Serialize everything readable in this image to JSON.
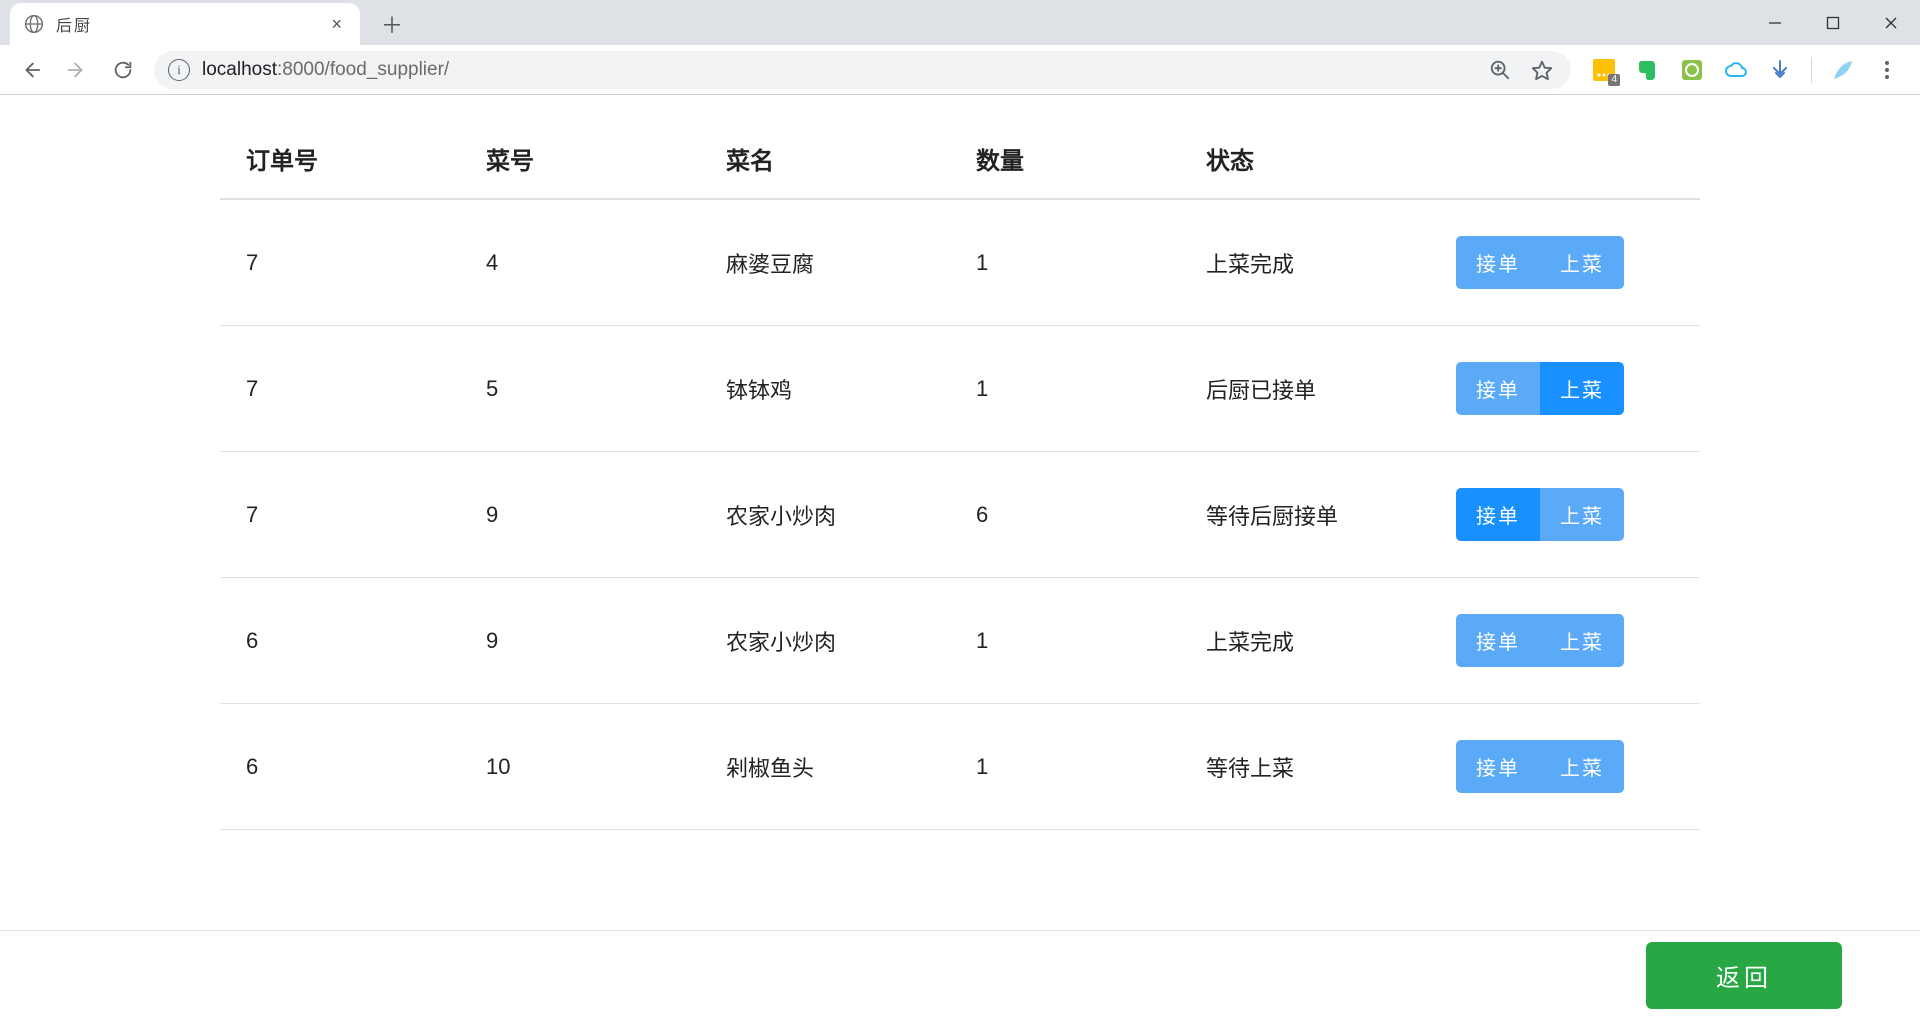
{
  "browser": {
    "tab_title": "后厨",
    "url_host": "localhost",
    "url_port": ":8000",
    "url_path": "/food_supplier/",
    "ext_badge": "4"
  },
  "table": {
    "headers": {
      "order_id": "订单号",
      "dish_id": "菜号",
      "dish_name": "菜名",
      "qty": "数量",
      "status": "状态"
    },
    "action_accept": "接单",
    "action_serve": "上菜",
    "rows": [
      {
        "order_id": "7",
        "dish_id": "4",
        "dish_name": "麻婆豆腐",
        "qty": "1",
        "status": "上菜完成",
        "accept_active": false,
        "serve_active": false
      },
      {
        "order_id": "7",
        "dish_id": "5",
        "dish_name": "钵钵鸡",
        "qty": "1",
        "status": "后厨已接单",
        "accept_active": false,
        "serve_active": true
      },
      {
        "order_id": "7",
        "dish_id": "9",
        "dish_name": "农家小炒肉",
        "qty": "6",
        "status": "等待后厨接单",
        "accept_active": true,
        "serve_active": false
      },
      {
        "order_id": "6",
        "dish_id": "9",
        "dish_name": "农家小炒肉",
        "qty": "1",
        "status": "上菜完成",
        "accept_active": false,
        "serve_active": false
      },
      {
        "order_id": "6",
        "dish_id": "10",
        "dish_name": "剁椒鱼头",
        "qty": "1",
        "status": "等待上菜",
        "accept_active": false,
        "serve_active": false
      }
    ]
  },
  "footer": {
    "back_label": "返回"
  }
}
